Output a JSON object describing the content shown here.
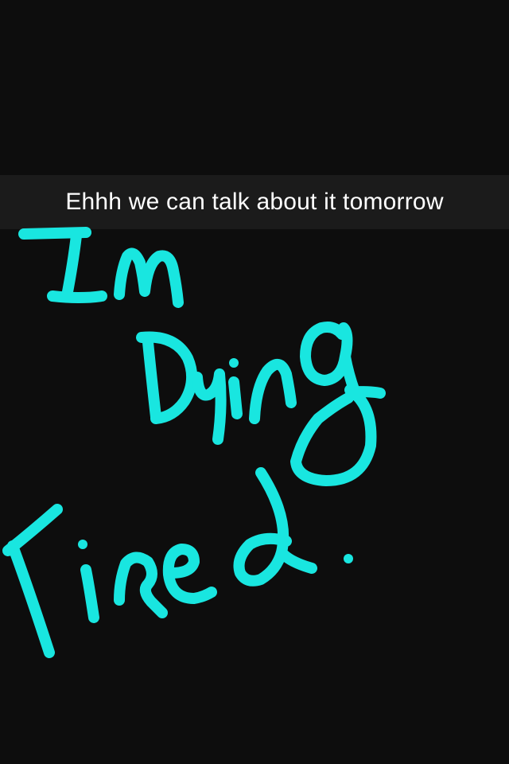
{
  "caption": {
    "text": "Ehhh we can talk about it tomorrow"
  },
  "doodle": {
    "handwritten_text": "Im Dying Tired.",
    "color": "#19e6e0"
  },
  "colors": {
    "background": "#0d0d0d",
    "caption_text": "#ffffff"
  }
}
